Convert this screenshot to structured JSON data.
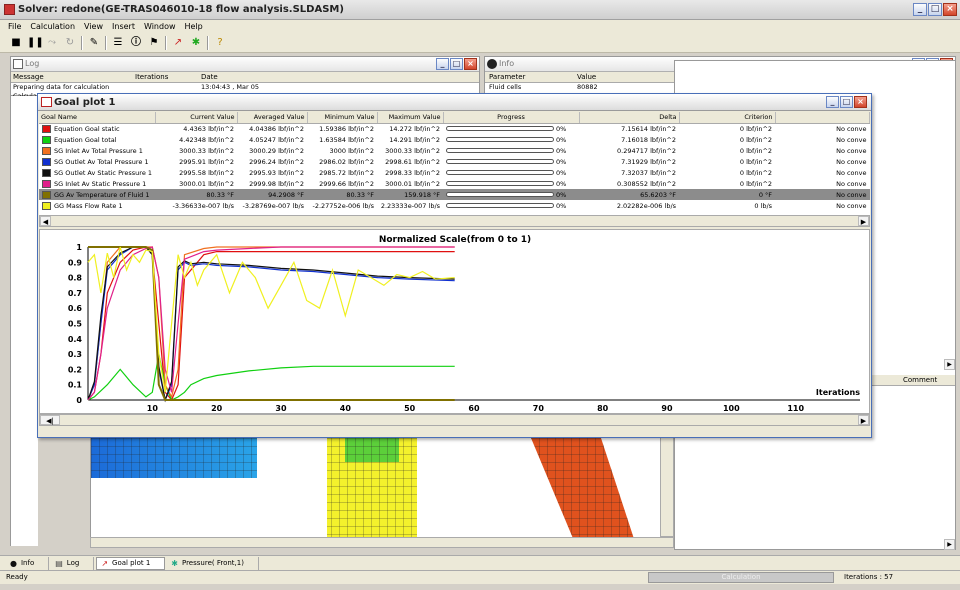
{
  "window": {
    "title": "Solver: redone(GE-TRAS046010-18 flow analysis.SLDASM)"
  },
  "menu": [
    "File",
    "Calculation",
    "View",
    "Insert",
    "Window",
    "Help"
  ],
  "log_panel": {
    "title": "Log",
    "columns": [
      "Message",
      "Iterations",
      "Date"
    ],
    "rows": [
      {
        "message": "Preparing data for calculation",
        "iterations": "",
        "date": "13:04:43 , Mar 05"
      },
      {
        "message": "Calcula",
        "iterations": "",
        "date": ""
      }
    ]
  },
  "info_panel": {
    "title": "Info",
    "columns": [
      "Parameter",
      "Value"
    ],
    "rows": [
      {
        "parameter": "Fluid cells",
        "value": "80882"
      }
    ],
    "comment_header": "Comment"
  },
  "goal_plot": {
    "title": "Goal plot 1",
    "columns": [
      "Goal Name",
      "Current Value",
      "Averaged Value",
      "Minimum Value",
      "Maximum Value",
      "Progress",
      "Delta",
      "Criterion",
      ""
    ],
    "goals": [
      {
        "name": "Equation Goal static",
        "color": "#e01010",
        "current": "4.4363 lbf/in^2",
        "averaged": "4.04386 lbf/in^2",
        "minimum": "1.59386 lbf/in^2",
        "maximum": "14.272 lbf/in^2",
        "progress": "0%",
        "delta": "7.15614 lbf/in^2",
        "criterion": "0 lbf/in^2",
        "status": "No conve"
      },
      {
        "name": "Equation Goal total",
        "color": "#10d010",
        "current": "4.42348 lbf/in^2",
        "averaged": "4.05247 lbf/in^2",
        "minimum": "1.63584 lbf/in^2",
        "maximum": "14.291 lbf/in^2",
        "progress": "0%",
        "delta": "7.16018 lbf/in^2",
        "criterion": "0 lbf/in^2",
        "status": "No conve"
      },
      {
        "name": "SG Inlet Av Total Pressure 1",
        "color": "#f07020",
        "current": "3000.33 lbf/in^2",
        "averaged": "3000.29 lbf/in^2",
        "minimum": "3000 lbf/in^2",
        "maximum": "3000.33 lbf/in^2",
        "progress": "0%",
        "delta": "0.294717 lbf/in^2",
        "criterion": "0 lbf/in^2",
        "status": "No conve"
      },
      {
        "name": "SG Outlet Av Total Pressure 1",
        "color": "#1030d0",
        "current": "2995.91 lbf/in^2",
        "averaged": "2996.24 lbf/in^2",
        "minimum": "2986.02 lbf/in^2",
        "maximum": "2998.61 lbf/in^2",
        "progress": "0%",
        "delta": "7.31929 lbf/in^2",
        "criterion": "0 lbf/in^2",
        "status": "No conve"
      },
      {
        "name": "SG Outlet Av Static Pressure 1",
        "color": "#101010",
        "current": "2995.58 lbf/in^2",
        "averaged": "2995.93 lbf/in^2",
        "minimum": "2985.72 lbf/in^2",
        "maximum": "2998.33 lbf/in^2",
        "progress": "0%",
        "delta": "7.32037 lbf/in^2",
        "criterion": "0 lbf/in^2",
        "status": "No conve"
      },
      {
        "name": "SG Inlet Av Static Pressure 1",
        "color": "#e0208a",
        "current": "3000.01 lbf/in^2",
        "averaged": "2999.98 lbf/in^2",
        "minimum": "2999.66 lbf/in^2",
        "maximum": "3000.01 lbf/in^2",
        "progress": "0%",
        "delta": "0.308552 lbf/in^2",
        "criterion": "0 lbf/in^2",
        "status": "No conve"
      },
      {
        "name": "GG Av Temperature of Fluid 1",
        "color": "#807000",
        "current": "80.33 °F",
        "averaged": "94.2908 °F",
        "minimum": "80.33 °F",
        "maximum": "159.918 °F",
        "progress": "0%",
        "delta": "65.6203 °F",
        "criterion": "0 °F",
        "status": "No conve",
        "selected": true
      },
      {
        "name": "GG Mass Flow Rate 1",
        "color": "#f0f020",
        "current": "-3.36633e-007 lb/s",
        "averaged": "-3.28769e-007 lb/s",
        "minimum": "-2.27752e-006 lb/s",
        "maximum": "2.23333e-007 lb/s",
        "progress": "0%",
        "delta": "2.02282e-006 lb/s",
        "criterion": "0 lb/s",
        "status": "No conve"
      }
    ]
  },
  "chart_data": {
    "type": "line",
    "title": "Normalized Scale(from 0 to 1)",
    "xlabel": "Iterations",
    "ylabel": "",
    "xlim": [
      0,
      120
    ],
    "ylim": [
      0,
      1
    ],
    "x_ticks": [
      10,
      20,
      30,
      40,
      50,
      60,
      70,
      80,
      90,
      100,
      110
    ],
    "y_ticks": [
      0.0,
      0.1,
      0.2,
      0.3,
      0.4,
      0.5,
      0.6,
      0.7,
      0.8,
      0.9,
      1.0
    ],
    "series": [
      {
        "color": "#e01010",
        "x": [
          0,
          1,
          2,
          3,
          5,
          7,
          9,
          10,
          11,
          12,
          13,
          14,
          15,
          18,
          20,
          25,
          30,
          35,
          40,
          45,
          50,
          57
        ],
        "y": [
          0,
          0.05,
          0.3,
          0.7,
          0.9,
          0.98,
          1,
          0.95,
          0.5,
          0.05,
          0,
          0.1,
          0.8,
          0.95,
          0.97,
          0.97,
          0.97,
          0.97,
          0.97,
          0.97,
          0.97,
          0.97
        ]
      },
      {
        "color": "#10d010",
        "x": [
          0,
          1,
          3,
          5,
          7,
          9,
          10,
          11,
          12,
          13,
          14,
          15,
          16,
          18,
          20,
          25,
          30,
          35,
          40,
          45,
          50,
          57
        ],
        "y": [
          0,
          0.02,
          0.1,
          0.2,
          0.1,
          0.02,
          0.05,
          0.3,
          0.1,
          0,
          0.02,
          0.05,
          0.1,
          0.14,
          0.16,
          0.19,
          0.21,
          0.22,
          0.22,
          0.22,
          0.22,
          0.22
        ]
      },
      {
        "color": "#f07020",
        "x": [
          0,
          1,
          2,
          3,
          5,
          7,
          9,
          10,
          11,
          12,
          13,
          14,
          15,
          18,
          20,
          25,
          30,
          40,
          50,
          57
        ],
        "y": [
          0,
          0.1,
          0.5,
          0.9,
          1,
          1,
          1,
          1,
          0.8,
          0.1,
          0.02,
          0.2,
          0.95,
          0.99,
          1,
          1,
          1,
          1,
          1,
          1
        ]
      },
      {
        "color": "#1030d0",
        "x": [
          0,
          1,
          2,
          3,
          5,
          7,
          9,
          10,
          11,
          12,
          13,
          14,
          15,
          16,
          18,
          20,
          25,
          30,
          35,
          40,
          45,
          50,
          57
        ],
        "y": [
          0,
          0.1,
          0.5,
          0.85,
          0.95,
          1,
          1,
          0.95,
          0.2,
          0,
          0.1,
          0.85,
          0.9,
          0.88,
          0.89,
          0.88,
          0.87,
          0.85,
          0.84,
          0.82,
          0.8,
          0.79,
          0.78
        ]
      },
      {
        "color": "#101010",
        "x": [
          0,
          1,
          2,
          3,
          5,
          7,
          9,
          10,
          11,
          12,
          13,
          14,
          15,
          16,
          18,
          20,
          25,
          30,
          35,
          40,
          45,
          50,
          57
        ],
        "y": [
          0,
          0.12,
          0.55,
          0.87,
          0.96,
          1,
          1,
          0.95,
          0.22,
          0,
          0.12,
          0.87,
          0.91,
          0.89,
          0.9,
          0.89,
          0.88,
          0.86,
          0.85,
          0.83,
          0.81,
          0.8,
          0.79
        ]
      },
      {
        "color": "#e0208a",
        "x": [
          0,
          1,
          2,
          3,
          5,
          7,
          9,
          10,
          11,
          12,
          13,
          14,
          15,
          18,
          20,
          25,
          30,
          40,
          50,
          57
        ],
        "y": [
          0,
          0.05,
          0.3,
          0.6,
          0.85,
          0.95,
          0.99,
          1,
          0.8,
          0.2,
          0.05,
          0.5,
          0.92,
          0.97,
          0.98,
          0.99,
          1,
          1,
          1,
          1
        ]
      },
      {
        "color": "#807000",
        "x": [
          0,
          1,
          9,
          10,
          11,
          12,
          12.5,
          13,
          14,
          57
        ],
        "y": [
          1,
          1,
          1,
          0.98,
          0.1,
          0,
          0,
          0,
          0,
          0
        ]
      },
      {
        "color": "#f0f020",
        "x": [
          0,
          1,
          2,
          3,
          4,
          5,
          6,
          7,
          8,
          9,
          10,
          11,
          12,
          13,
          14,
          15,
          16,
          17,
          18,
          20,
          22,
          24,
          26,
          28,
          30,
          32,
          34,
          36,
          38,
          40,
          42,
          44,
          46,
          48,
          50,
          52,
          54,
          57
        ],
        "y": [
          0.9,
          0.95,
          0.7,
          0.96,
          0.8,
          1,
          0.85,
          0.95,
          0.9,
          0.98,
          0.97,
          0.3,
          0.05,
          0.5,
          0.95,
          0.8,
          0.9,
          0.75,
          0.85,
          0.95,
          0.7,
          0.9,
          0.8,
          0.6,
          0.75,
          0.9,
          0.65,
          0.6,
          0.85,
          0.55,
          0.85,
          0.8,
          0.75,
          0.82,
          0.8,
          0.84,
          0.79,
          0.8
        ]
      }
    ]
  },
  "tabs": [
    {
      "label": "Info",
      "icon": "info-icon"
    },
    {
      "label": "Log",
      "icon": "log-icon"
    },
    {
      "label": "Goal plot 1",
      "icon": "goal-plot-icon",
      "active": true
    },
    {
      "label": "Pressure( Front,1)",
      "icon": "pressure-icon"
    }
  ],
  "status": {
    "left": "Ready",
    "calc_label": "Calculation",
    "iterations": "Iterations : 57"
  },
  "colors": {
    "accent": "#496fb8",
    "selected_row": "#8c8c8c"
  }
}
